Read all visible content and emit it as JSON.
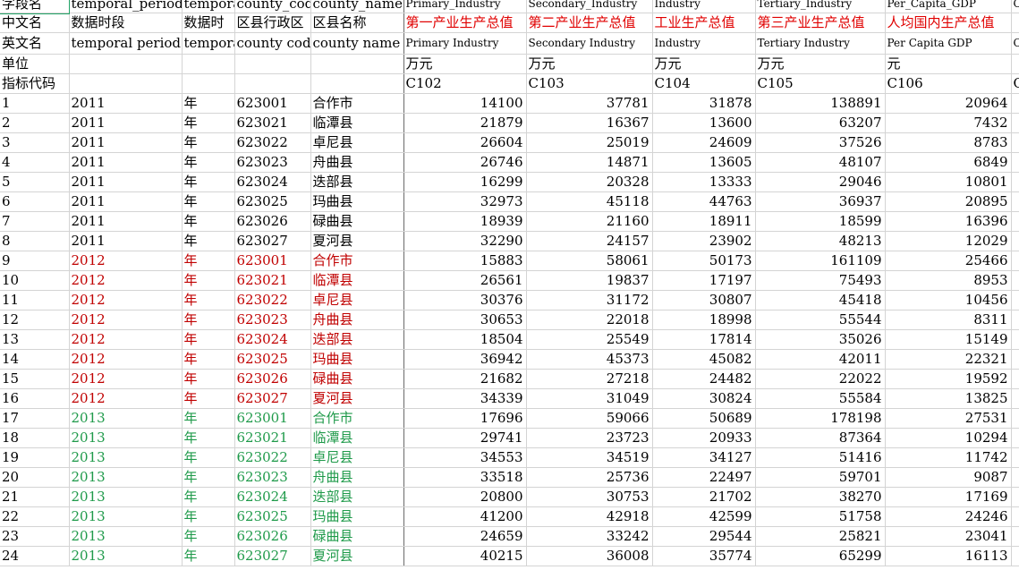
{
  "header_rows": [
    [
      "字段名",
      "temporal_period",
      "temporal",
      "county_code",
      "county_name",
      "Primary_Industry",
      "Secondary_Industry",
      "Industry",
      "Tertiary_Industry",
      "Per_Capita_GDP",
      "C"
    ],
    [
      "中文名",
      "数据时段",
      "数据时",
      "区县行政区",
      "区县名称",
      "第一产业生产总值",
      "第二产业生产总值",
      "工业生产总值",
      "第三产业生产总值",
      "人均国内生产总值",
      ""
    ],
    [
      "英文名",
      "temporal period",
      "temporal",
      "county code",
      "county name",
      "Primary Industry",
      "Secondary Industry",
      "Industry",
      "Tertiary Industry",
      "Per Capita GDP",
      "C"
    ],
    [
      "单位",
      "",
      "",
      "",
      "",
      "万元",
      "万元",
      "万元",
      "万元",
      "元",
      ""
    ],
    [
      "指标代码",
      "",
      "",
      "",
      "",
      "C102",
      "C103",
      "C104",
      "C105",
      "C106",
      "C"
    ]
  ],
  "rows": [
    [
      "1",
      "2011",
      "年",
      "623001",
      "合作市",
      "14100",
      "37781",
      "31878",
      "138891",
      "20964"
    ],
    [
      "2",
      "2011",
      "年",
      "623021",
      "临潭县",
      "21879",
      "16367",
      "13600",
      "63207",
      "7432"
    ],
    [
      "3",
      "2011",
      "年",
      "623022",
      "卓尼县",
      "26604",
      "25019",
      "24609",
      "37526",
      "8783"
    ],
    [
      "4",
      "2011",
      "年",
      "623023",
      "舟曲县",
      "26746",
      "14871",
      "13605",
      "48107",
      "6849"
    ],
    [
      "5",
      "2011",
      "年",
      "623024",
      "迭部县",
      "16299",
      "20328",
      "13333",
      "29046",
      "10801"
    ],
    [
      "6",
      "2011",
      "年",
      "623025",
      "玛曲县",
      "32973",
      "45118",
      "44763",
      "36937",
      "20895"
    ],
    [
      "7",
      "2011",
      "年",
      "623026",
      "碌曲县",
      "18939",
      "21160",
      "18911",
      "18599",
      "16396"
    ],
    [
      "8",
      "2011",
      "年",
      "623027",
      "夏河县",
      "32290",
      "24157",
      "23902",
      "48213",
      "12029"
    ],
    [
      "9",
      "2012",
      "年",
      "623001",
      "合作市",
      "15883",
      "58061",
      "50173",
      "161109",
      "25466"
    ],
    [
      "10",
      "2012",
      "年",
      "623021",
      "临潭县",
      "26561",
      "19837",
      "17197",
      "75493",
      "8953"
    ],
    [
      "11",
      "2012",
      "年",
      "623022",
      "卓尼县",
      "30376",
      "31172",
      "30807",
      "45418",
      "10456"
    ],
    [
      "12",
      "2012",
      "年",
      "623023",
      "舟曲县",
      "30653",
      "22018",
      "18998",
      "55544",
      "8311"
    ],
    [
      "13",
      "2012",
      "年",
      "623024",
      "迭部县",
      "18504",
      "25549",
      "17814",
      "35026",
      "15149"
    ],
    [
      "14",
      "2012",
      "年",
      "623025",
      "玛曲县",
      "36942",
      "45373",
      "45082",
      "42011",
      "22321"
    ],
    [
      "15",
      "2012",
      "年",
      "623026",
      "碌曲县",
      "21682",
      "27218",
      "24482",
      "22022",
      "19592"
    ],
    [
      "16",
      "2012",
      "年",
      "623027",
      "夏河县",
      "34339",
      "31049",
      "30824",
      "55584",
      "13825"
    ],
    [
      "17",
      "2013",
      "年",
      "623001",
      "合作市",
      "17696",
      "59066",
      "50689",
      "178198",
      "27531"
    ],
    [
      "18",
      "2013",
      "年",
      "623021",
      "临潭县",
      "29741",
      "23723",
      "20933",
      "87364",
      "10294"
    ],
    [
      "19",
      "2013",
      "年",
      "623022",
      "卓尼县",
      "34553",
      "34519",
      "34127",
      "51416",
      "11742"
    ],
    [
      "20",
      "2013",
      "年",
      "623023",
      "舟曲县",
      "33518",
      "25736",
      "22497",
      "59701",
      "9087"
    ],
    [
      "21",
      "2013",
      "年",
      "623024",
      "迭部县",
      "20800",
      "30753",
      "21702",
      "38270",
      "17169"
    ],
    [
      "22",
      "2013",
      "年",
      "623025",
      "玛曲县",
      "41200",
      "42918",
      "42599",
      "51758",
      "24246"
    ],
    [
      "23",
      "2013",
      "年",
      "623026",
      "碌曲县",
      "24659",
      "33242",
      "29544",
      "25821",
      "23041"
    ],
    [
      "24",
      "2013",
      "年",
      "623027",
      "夏河县",
      "40215",
      "36008",
      "35774",
      "65299",
      "16113"
    ]
  ],
  "colors": {
    "year_2012": "#c00000",
    "year_2013": "#1f9a4a",
    "header_chinese": "#e00000",
    "gridline": "#d4d4d4"
  }
}
